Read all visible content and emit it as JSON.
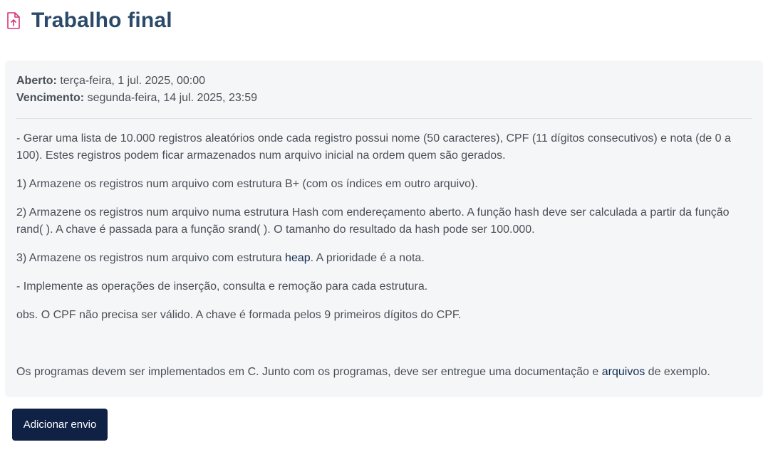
{
  "header": {
    "title": "Trabalho final",
    "icon": "file-upload-icon",
    "icon_color": "#d6337b"
  },
  "dates": {
    "opened_label": "Aberto:",
    "opened_value": " terça-feira, 1 jul. 2025, 00:00",
    "due_label": "Vencimento:",
    "due_value": " segunda-feira, 14 jul. 2025, 23:59"
  },
  "description": {
    "p1": "- Gerar uma lista de 10.000 registros aleatórios onde cada registro possui nome (50 caracteres), CPF (11 dígitos consecutivos) e  nota (de 0 a 100). Estes registros podem ficar armazenados num arquivo inicial na ordem quem são gerados.",
    "p2": "1) Armazene os registros num arquivo com estrutura B+ (com os índices em outro arquivo).",
    "p3": "2) Armazene os registros num arquivo numa estrutura Hash com endereçamento aberto. A função hash deve ser calculada a partir da função rand(  ). A chave é passada para a função srand(  ). O tamanho do resultado da hash pode ser 100.000.",
    "p4_before": "3) Armazene os registros num arquivo com estrutura ",
    "p4_link": "heap",
    "p4_after": ". A prioridade é a nota.",
    "p5": "- Implemente as operações de inserção, consulta e remoção para cada estrutura.",
    "p6": "obs. O CPF não precisa ser válido. A chave é formada pelos 9 primeiros dígitos do CPF.",
    "p7_before": "Os programas devem ser implementados em C. Junto com os programas, deve ser entregue uma documentação e ",
    "p7_link": "arquivos",
    "p7_after": " de exemplo."
  },
  "actions": {
    "submit_label": "Adicionar envio"
  },
  "colors": {
    "title": "#2b4a6a",
    "link": "#0f2d52",
    "button_bg": "#0f2145",
    "box_bg": "#f5f6f8"
  }
}
